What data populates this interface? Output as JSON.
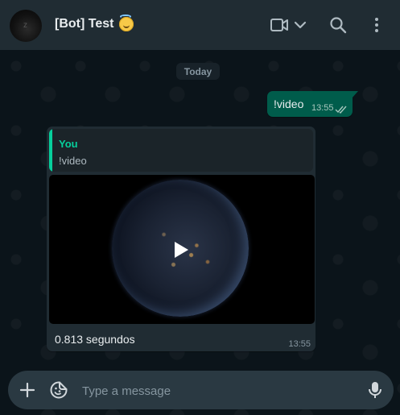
{
  "header": {
    "title": "[Bot] Test",
    "title_emoji": "smiling-face-with-halo",
    "icons": [
      "video-call-icon",
      "chevron-down-icon",
      "search-icon",
      "menu-icon"
    ]
  },
  "chat": {
    "date_label": "Today",
    "outgoing": {
      "text": "!video",
      "time": "13:55",
      "status": "read-ticks-icon"
    },
    "incoming": {
      "quote_author": "You",
      "quote_text": "!video",
      "media": "video",
      "caption": "0.813 segundos",
      "time": "13:55"
    }
  },
  "composer": {
    "placeholder": "Type a message",
    "icons": [
      "plus-icon",
      "sticker-icon",
      "microphone-icon"
    ]
  },
  "colors": {
    "header_bg": "#202c33",
    "chat_bg": "#0b141a",
    "outgoing_bubble": "#005c4b",
    "incoming_bubble": "#202c33",
    "quote_accent": "#06cf9c",
    "composer_bg": "#2a3942"
  }
}
